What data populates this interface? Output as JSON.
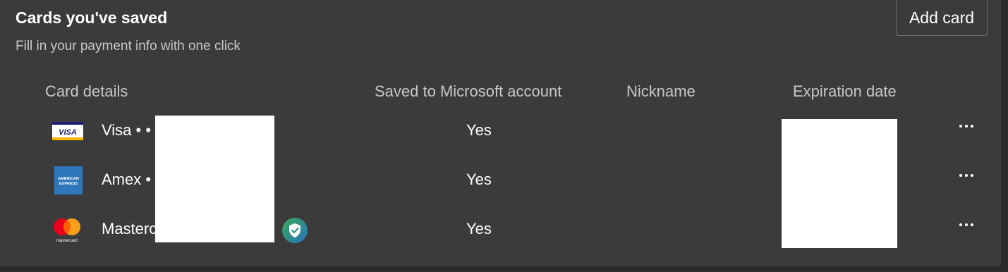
{
  "header": {
    "title": "Cards you've saved",
    "subtitle": "Fill in your payment info with one click",
    "add_label": "Add card"
  },
  "columns": {
    "card_details": "Card details",
    "saved_to_account": "Saved to Microsoft account",
    "nickname": "Nickname",
    "expiration": "Expiration date"
  },
  "cards": [
    {
      "brand": "visa",
      "label": "Visa • •",
      "saved": "Yes",
      "logo_text": "VISA",
      "icon": "visa-logo-icon"
    },
    {
      "brand": "amex",
      "label": "Amex •",
      "saved": "Yes",
      "logo_text": "AMERICAN EXPRESS",
      "icon": "amex-logo-icon"
    },
    {
      "brand": "mastercard",
      "label": "Mastercard",
      "saved": "Yes",
      "logo_text": "mastercard",
      "icon": "mastercard-logo-icon",
      "verified_icon": "verified-shield-icon"
    }
  ],
  "colors": {
    "background": "#3b3b3b",
    "text": "#ffffff",
    "muted_text": "#c7c7c7",
    "button_border": "#6f6f6f",
    "shield_gradient": [
      "#3aa858",
      "#2a6fc4"
    ]
  }
}
